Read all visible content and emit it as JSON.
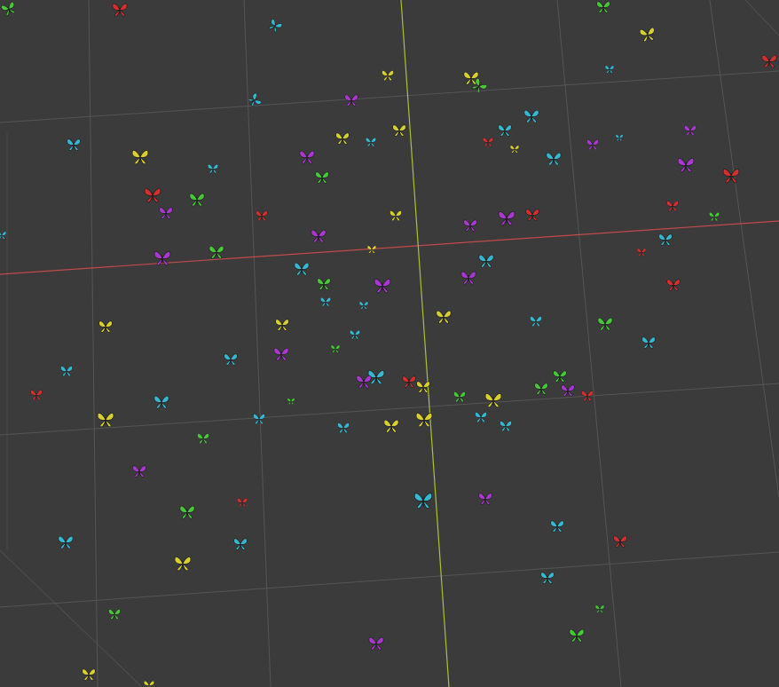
{
  "viewport": {
    "background": "#3b3b3b",
    "grid_color": "#545454",
    "x_axis_color": "#c24a4a",
    "y_axis_color": "#a8c23c",
    "object_type": "butterfly-particles"
  },
  "butterfly_colors": {
    "red": "#d23030",
    "yellow": "#d8d030",
    "cyan": "#38b8d0",
    "green": "#48c838",
    "purple": "#a838d0"
  }
}
